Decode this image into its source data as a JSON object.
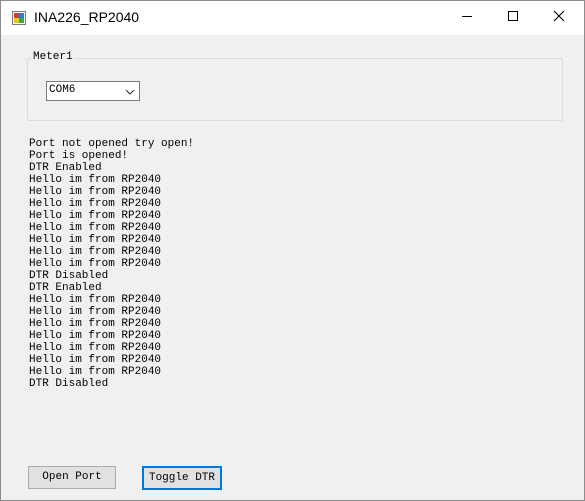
{
  "window": {
    "title": "INA226_RP2040",
    "icon": "app-icon",
    "controls": [
      "minimize-icon",
      "maximize-icon",
      "close-icon"
    ]
  },
  "meter_group": {
    "label": "Meter1",
    "port_select": {
      "selected": "COM6",
      "icon": "chevron-down-icon"
    }
  },
  "log": {
    "lines": [
      "Port not opened try open!",
      "Port is opened!",
      "DTR Enabled",
      "Hello im from RP2040",
      "Hello im from RP2040",
      "Hello im from RP2040",
      "Hello im from RP2040",
      "Hello im from RP2040",
      "Hello im from RP2040",
      "Hello im from RP2040",
      "Hello im from RP2040",
      "DTR Disabled",
      "DTR Enabled",
      "Hello im from RP2040",
      "Hello im from RP2040",
      "Hello im from RP2040",
      "Hello im from RP2040",
      "Hello im from RP2040",
      "Hello im from RP2040",
      "Hello im from RP2040",
      "DTR Disabled"
    ]
  },
  "buttons": {
    "open_port": "Open Port",
    "toggle_dtr": "Toggle DTR"
  },
  "colors": {
    "window_bg": "#f0f0f0",
    "titlebar_bg": "#ffffff",
    "focus_border": "#0078d7",
    "button_bg": "#e1e1e1"
  }
}
